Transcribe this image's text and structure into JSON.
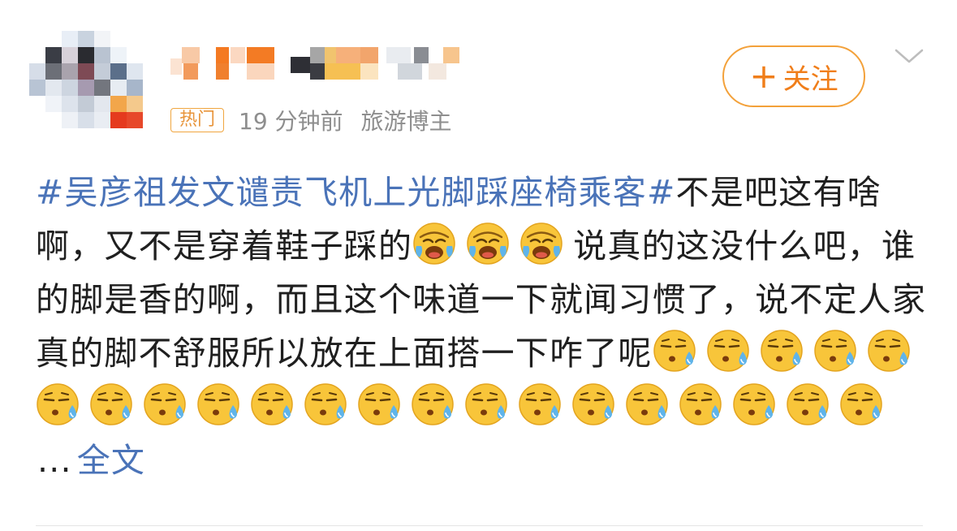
{
  "header": {
    "follow_label": "关注",
    "hot_badge": "热门",
    "time": "19 分钟前",
    "user_tag": "旅游博主"
  },
  "post": {
    "topic": "#吴彦祖发文谴责飞机上光脚踩座椅乘客#",
    "text1": "不是吧这有啥啊，又不是穿着鞋子踩的",
    "text2": "说真的这没什么吧，谁的脚是香的啊，而且这个味道一下就闻习惯了，说不定人家真的脚不舒服所以放在上面搭一下咋了呢",
    "ellipsis": "...",
    "full_text_link": "全文"
  },
  "icons": {
    "follow_plus": "plus-icon",
    "more_menu": "chevron-down-icon",
    "emoji_laugh_cry": "laugh-cry-emoji",
    "emoji_sweat": "sweat-emoji"
  },
  "colors": {
    "accent_orange": "#f07e1a",
    "link_blue": "#4a73b8",
    "meta_gray": "#8e8e8e"
  }
}
